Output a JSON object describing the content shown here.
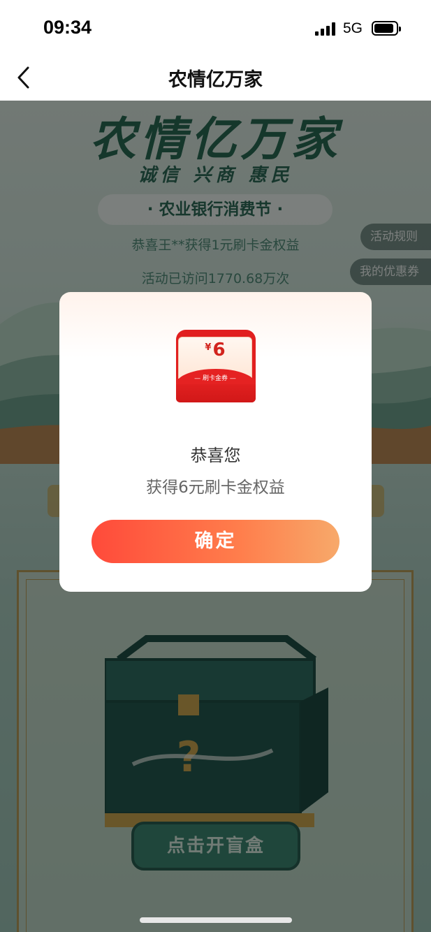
{
  "status_bar": {
    "time": "09:34",
    "network": "5G"
  },
  "nav": {
    "title": "农情亿万家",
    "back_icon": "chevron-left-icon"
  },
  "hero": {
    "title": "农情亿万家",
    "slogan": "诚信 兴商 惠民",
    "festival": "· 农业银行消费节 ·",
    "winner_ticker": "恭喜王**获得1元刷卡金权益",
    "visit_count": "活动已访问1770.68万次"
  },
  "side_buttons": {
    "rules": "活动规则",
    "coupons": "我的优惠券"
  },
  "blind_box": {
    "open_button": "点击开盲盒"
  },
  "modal": {
    "coupon_currency": "¥",
    "coupon_amount": "6",
    "coupon_label": "— 刷卡金券 —",
    "title": "恭喜您",
    "description": "获得6元刷卡金权益",
    "confirm": "确定"
  },
  "colors": {
    "accent_gradient_start": "#ff4a3a",
    "accent_gradient_end": "#f7a96a",
    "coupon_red": "#e11f1f",
    "theme_green": "#2a6a54"
  }
}
